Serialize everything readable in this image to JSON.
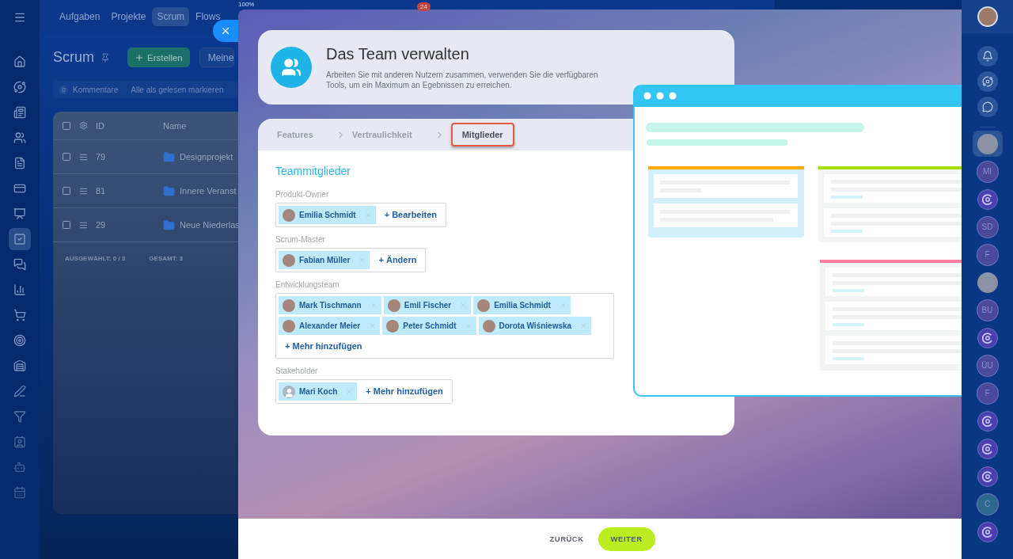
{
  "left_nav": [
    {
      "selected": false
    },
    {
      "selected": false
    },
    {
      "selected": false
    },
    {
      "selected": false
    },
    {
      "selected": false
    },
    {
      "selected": false
    },
    {
      "selected": false
    },
    {
      "selected": true
    },
    {
      "selected": false
    },
    {
      "selected": false
    },
    {
      "selected": false
    },
    {
      "selected": false
    },
    {
      "selected": false
    },
    {
      "selected": false
    },
    {
      "selected": false
    },
    {
      "selected": false
    },
    {
      "selected": false
    },
    {
      "selected": false
    }
  ],
  "top_tabs": [
    {
      "label": "Aufgaben",
      "selected": false
    },
    {
      "label": "Projekte",
      "selected": false
    },
    {
      "label": "Scrum",
      "selected": true
    },
    {
      "label": "Flows",
      "selected": false
    }
  ],
  "zoom_label": "100%",
  "counter_badge": "24",
  "page": {
    "title": "Scrum",
    "create_button": "Erstellen",
    "filter_button": "Meine"
  },
  "comments": {
    "count": "0",
    "label": "Kommentare",
    "mark_read": "Alle als gelesen markieren"
  },
  "table": {
    "columns": [
      "ID",
      "Name"
    ],
    "rows": [
      {
        "id": "79",
        "name": "Designprojekt"
      },
      {
        "id": "81",
        "name": "Innere Veranst"
      },
      {
        "id": "29",
        "name": "Neue Niederlas"
      }
    ],
    "footer": {
      "selected_label": "AUSGEWÄHLT:",
      "selected_value": "0 / 3",
      "total_label": "GESAMT:",
      "total_value": "3"
    }
  },
  "slider": {
    "header": {
      "title": "Das Team verwalten",
      "description": "Arbeiten Sie mit anderen Nutzern zusammen, verwenden Sie die verfügbaren Tools, um ein Maximum an Egebnissen zu erreichen."
    },
    "steps": [
      {
        "label": "Features",
        "selected": false
      },
      {
        "label": "Vertraulichkeit",
        "selected": false
      },
      {
        "label": "Mitglieder",
        "selected": true
      }
    ],
    "section_title": "Teammitglieder",
    "fields": [
      {
        "label": "Produkt-Owner",
        "members": [
          {
            "name": "Emilia Schmidt",
            "kind": "photo"
          }
        ],
        "action": "+ Bearbeiten"
      },
      {
        "label": "Scrum-Master",
        "members": [
          {
            "name": "Fabian Müller",
            "kind": "photo"
          }
        ],
        "action": "+ Ändern"
      },
      {
        "label": "Entwicklungsteam",
        "members": [
          {
            "name": "Mark Tischmann",
            "kind": "photo"
          },
          {
            "name": "Emil Fischer",
            "kind": "photo"
          },
          {
            "name": "Emilia Schmidt",
            "kind": "photo"
          },
          {
            "name": "Alexander Meier",
            "kind": "photo"
          },
          {
            "name": "Peter Schmidt",
            "kind": "photo"
          },
          {
            "name": "Dorota Wiśniewska",
            "kind": "photo"
          }
        ],
        "action": "+ Mehr hinzufügen"
      },
      {
        "label": "Stakeholder",
        "members": [
          {
            "name": "Mari Koch",
            "kind": "generic"
          }
        ],
        "action": "+ Mehr hinzufügen"
      }
    ],
    "back_button": "ZURÜCK",
    "next_button": "WEITER"
  },
  "right_bar": {
    "tools": [
      {
        "kind": "bell"
      },
      {
        "kind": "assistant"
      },
      {
        "kind": "chat"
      }
    ],
    "contacts": [
      {
        "kind": "photo",
        "selected": true
      },
      {
        "kind": "initials",
        "label": "MI",
        "color": "#4a4a9c",
        "selected": false
      },
      {
        "kind": "group",
        "selected": false
      },
      {
        "kind": "initials",
        "label": "SD",
        "color": "#4a4a9c",
        "selected": false
      },
      {
        "kind": "initials",
        "label": "F",
        "color": "#4a4a9c",
        "selected": false
      },
      {
        "kind": "photo",
        "selected": false
      },
      {
        "kind": "initials",
        "label": "BU",
        "color": "#4a4a9c",
        "selected": false
      },
      {
        "kind": "group",
        "selected": false
      },
      {
        "kind": "initials",
        "label": "ÜU",
        "color": "#4a4a9c",
        "selected": false
      },
      {
        "kind": "initials",
        "label": "F",
        "color": "#4a4a9c",
        "selected": false
      },
      {
        "kind": "group",
        "selected": false
      },
      {
        "kind": "group",
        "selected": false
      },
      {
        "kind": "group",
        "selected": false
      },
      {
        "kind": "initials",
        "label": "C",
        "color": "#2b6a8e",
        "selected": false
      },
      {
        "kind": "group",
        "selected": false
      }
    ]
  }
}
